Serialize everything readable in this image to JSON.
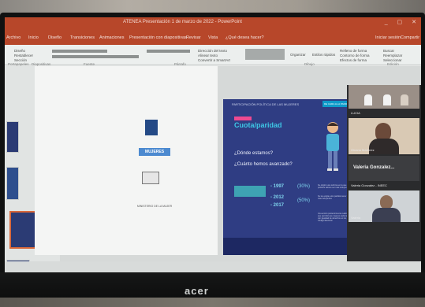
{
  "window": {
    "title": "ATENEA Presentación 1 de marzo de 2022 - PowerPoint",
    "controls": [
      "_",
      "▢",
      "✕"
    ]
  },
  "ribbon_tabs": [
    "Archivo",
    "Inicio",
    "Diseño",
    "Transiciones",
    "Animaciones",
    "Presentación con diapositivas",
    "Revisar",
    "Vista",
    "¿Qué desea hacer?",
    "Iniciar sesión",
    "Compartir"
  ],
  "ribbon_groups": [
    "Portapapeles",
    "Diapositivas",
    "Fuente",
    "Párrafo",
    "Dibujo",
    "Edición"
  ],
  "ribbon_commands": [
    "Diseño",
    "Restablecer",
    "Sección",
    "Buscar",
    "Reemplazar",
    "Seleccionar",
    "Organizar",
    "Estilos rápidos",
    "Dirección del texto",
    "Alinear texto",
    "Convertir a SmartArt",
    "Relleno de forma",
    "Contorno de forma",
    "Efectos de forma"
  ],
  "slide": {
    "header": "PARTICIPACIÓN POLÍTICA DE LAS MUJERES",
    "corner_tag": "DE CARA A LA PARIDAD",
    "title": "Cuota/paridad",
    "question_1": "¿Dónde estamos?",
    "question_2": "¿Cuánto hemos avanzado?",
    "rows": [
      {
        "year": "- 1997",
        "pct": "(30%)"
      },
      {
        "year": "- 2012",
        "pct": ""
      },
      {
        "year": "- 2017",
        "pct": "(50%)"
      }
    ],
    "note_1": "Se originó una reforma en la que los partidos políticos debían ser más incluyentes",
    "note_2": "Se les exigía a los partidos tener a las mujeres más incluyentes",
    "note_3": "Una acción posteriormente realizó un cambio que permitió que mujeres pudieran participar con igualdad de derechos en los procesos. Código Electoral."
  },
  "left_slide": {
    "logo_text": "MUJERES",
    "caption": "MINISTERIO DE LA MUJER"
  },
  "meeting": {
    "participants": [
      {
        "name": "",
        "label": ""
      },
      {
        "name": "LUCIA",
        "label": ""
      },
      {
        "name": "Ginana Martínez",
        "label": ""
      },
      {
        "name": "",
        "label": "Valeria Gonzalez..."
      },
      {
        "name": "Valeria Gonzalez - INEEC",
        "label": ""
      },
      {
        "name": "Valeria",
        "label": ""
      }
    ]
  },
  "monitor": {
    "brand": "acer"
  },
  "colors": {
    "ppt_red": "#b7472a",
    "slide_navy": "#2f3d83",
    "slide_cyan": "#3ec7e6",
    "accent_pink": "#ee4a91"
  }
}
